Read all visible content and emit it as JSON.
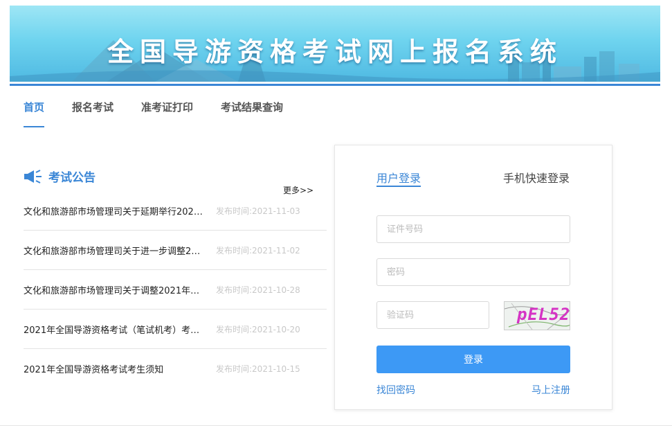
{
  "banner": {
    "title": "全国导游资格考试网上报名系统"
  },
  "nav": {
    "items": [
      {
        "label": "首页",
        "active": true
      },
      {
        "label": "报名考试",
        "active": false
      },
      {
        "label": "准考证打印",
        "active": false
      },
      {
        "label": "考试结果查询",
        "active": false
      }
    ]
  },
  "notices": {
    "title": "考试公告",
    "icon": "megaphone-icon",
    "more_label": "更多>>",
    "items": [
      {
        "title": "文化和旅游部市场管理司关于延期举行202…",
        "date": "发布时间:2021-11-03"
      },
      {
        "title": "文化和旅游部市场管理司关于进一步调整2…",
        "date": "发布时间:2021-11-02"
      },
      {
        "title": "文化和旅游部市场管理司关于调整2021年…",
        "date": "发布时间:2021-10-28"
      },
      {
        "title": "2021年全国导游资格考试（笔试机考）考…",
        "date": "发布时间:2021-10-20"
      },
      {
        "title": "2021年全国导游资格考试考生须知",
        "date": "发布时间:2021-10-15"
      }
    ]
  },
  "login": {
    "tabs": [
      {
        "label": "用户登录",
        "active": true
      },
      {
        "label": "手机快速登录",
        "active": false
      }
    ],
    "id_placeholder": "证件号码",
    "id_value": "",
    "password_placeholder": "密码",
    "password_value": "",
    "captcha_placeholder": "验证码",
    "captcha_value": "",
    "captcha_image_text": "pEL52",
    "submit_label": "登录",
    "forgot_label": "找回密码",
    "register_label": "马上注册"
  },
  "colors": {
    "accent": "#3a86d6",
    "button": "#3d99f5",
    "date": "#c8c8c8"
  }
}
